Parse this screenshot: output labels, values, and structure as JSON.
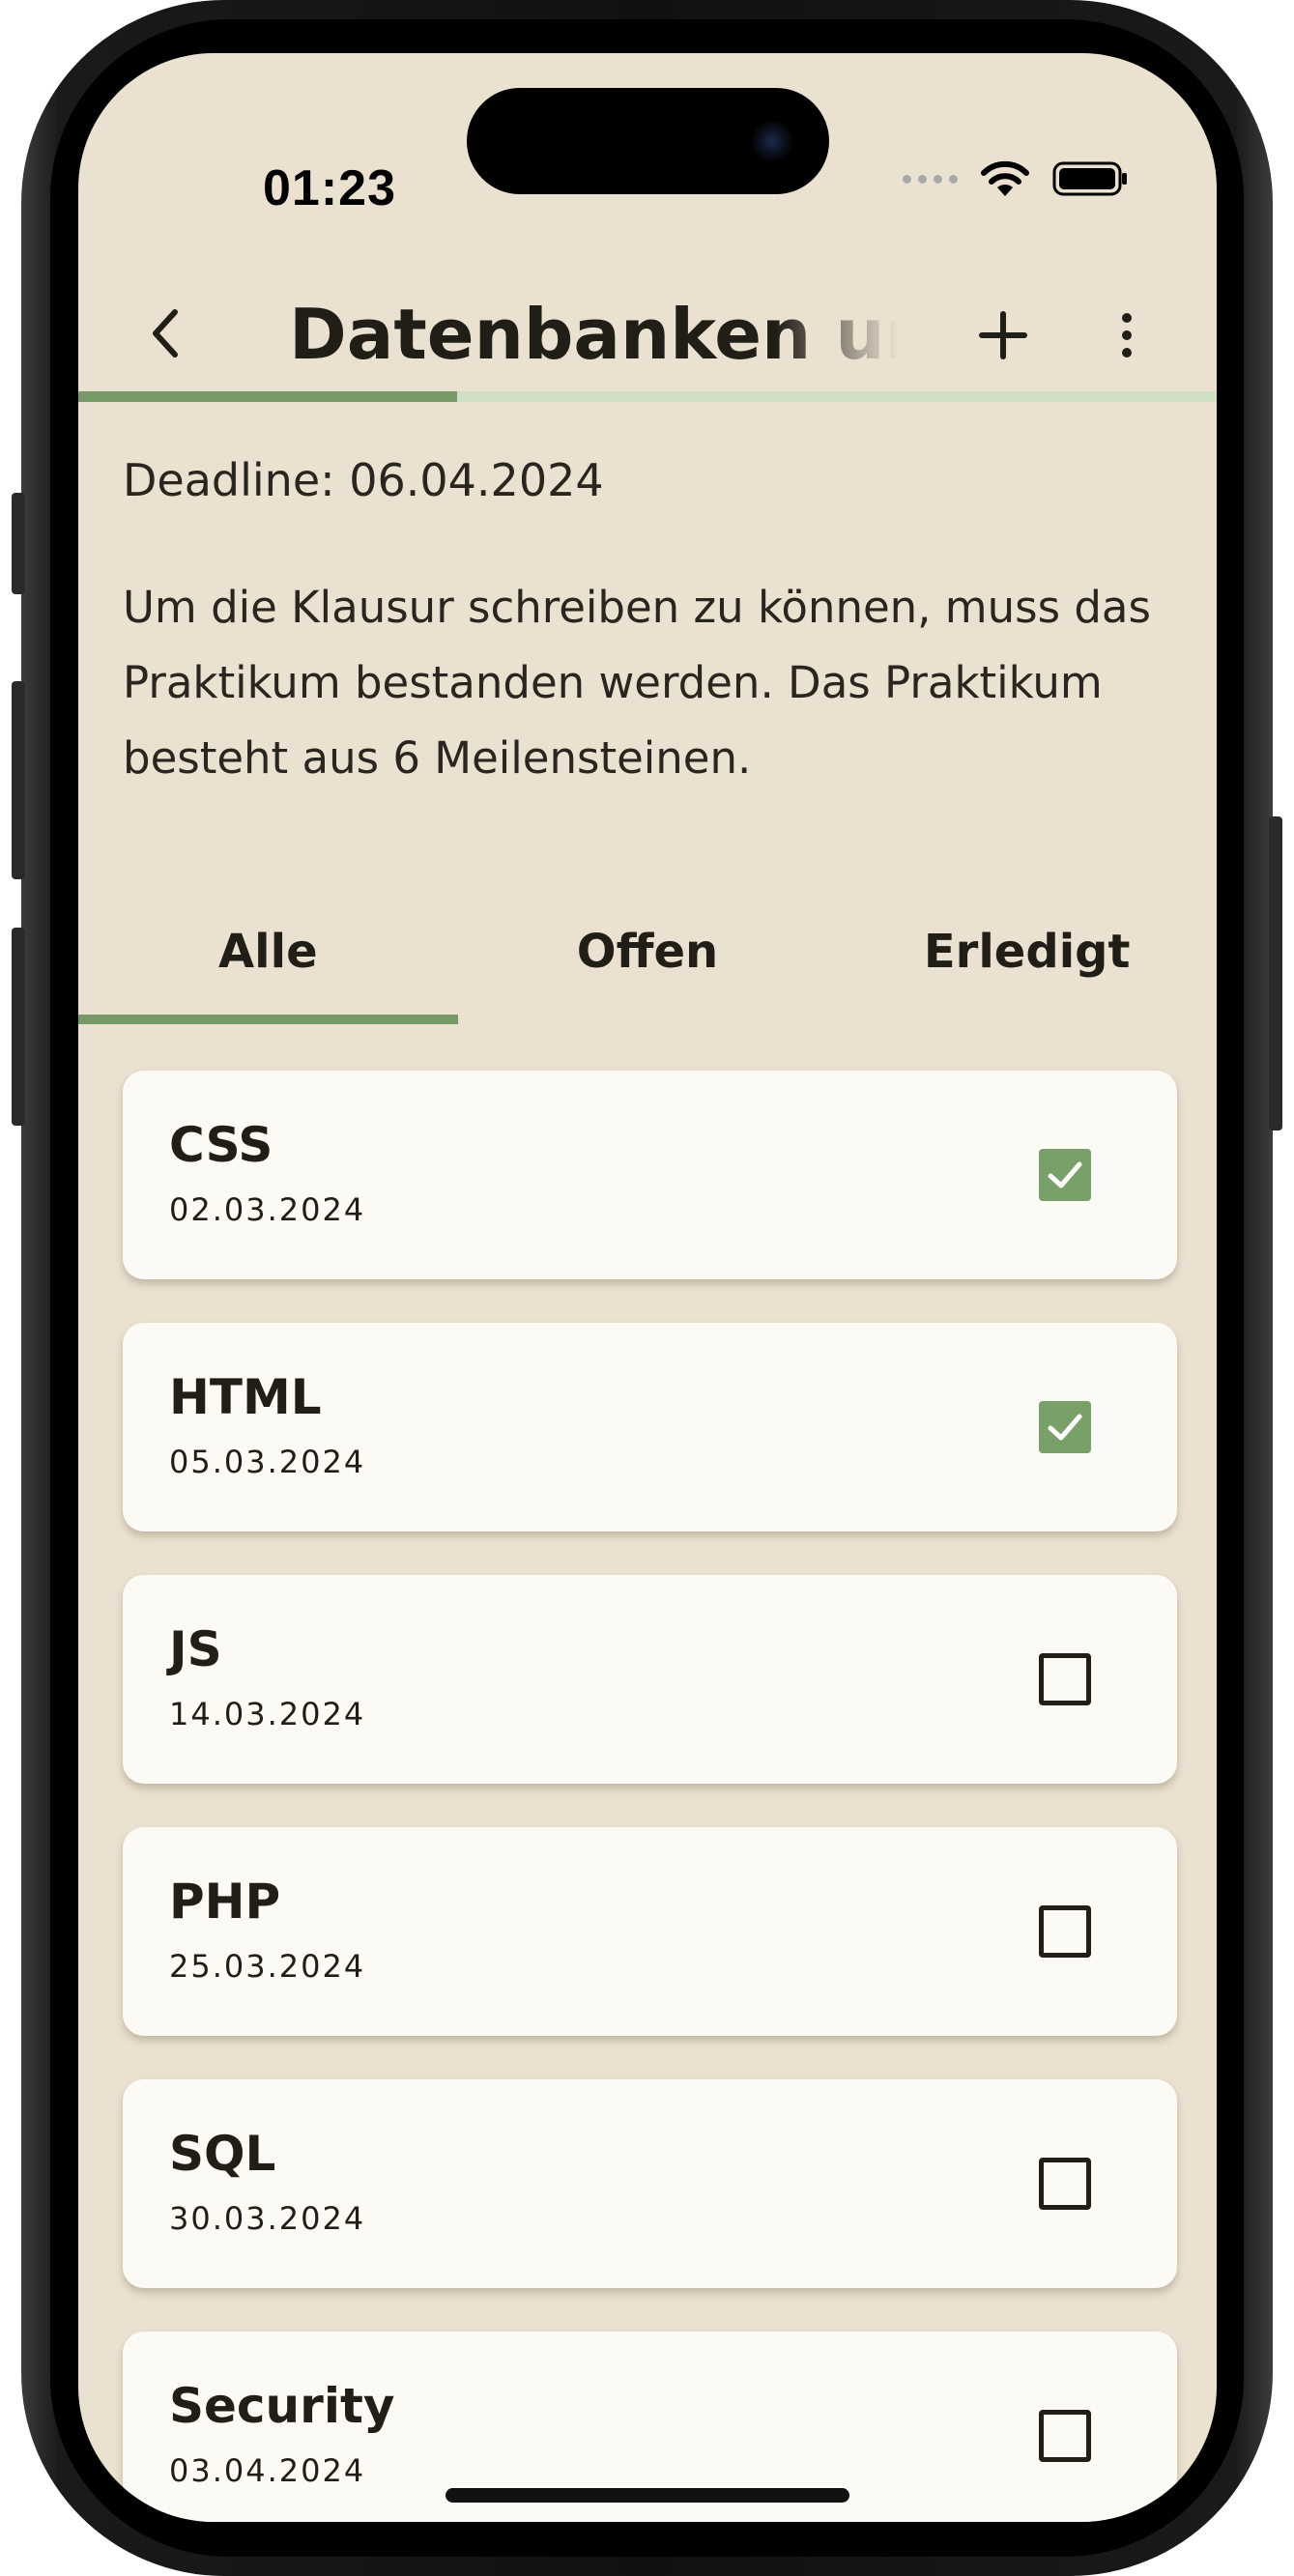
{
  "status_bar": {
    "time": "01:23"
  },
  "header": {
    "title": "Datenbanken und Webtechnologien",
    "back_icon": "chevron-left-icon",
    "add_icon": "plus-icon",
    "more_icon": "more-vertical-icon"
  },
  "progress": {
    "fraction": 0.333
  },
  "deadline": "Deadline: 06.04.2024",
  "description": "Um die Klausur schreiben zu können, muss das Praktikum bestanden werden. Das Praktikum besteht aus 6 Meilensteinen.",
  "tabs": [
    {
      "label": "Alle",
      "active": true
    },
    {
      "label": "Offen",
      "active": false
    },
    {
      "label": "Erledigt",
      "active": false
    }
  ],
  "milestones": [
    {
      "title": "CSS",
      "date": "02.03.2024",
      "done": true
    },
    {
      "title": "HTML",
      "date": "05.03.2024",
      "done": true
    },
    {
      "title": "JS",
      "date": "14.03.2024",
      "done": false
    },
    {
      "title": "PHP",
      "date": "25.03.2024",
      "done": false
    },
    {
      "title": "SQL",
      "date": "30.03.2024",
      "done": false
    },
    {
      "title": "Security",
      "date": "03.04.2024",
      "done": false
    }
  ],
  "colors": {
    "background": "#ebe1d1",
    "accent": "#779968",
    "card": "#fcfaf4",
    "text": "#211d17"
  }
}
